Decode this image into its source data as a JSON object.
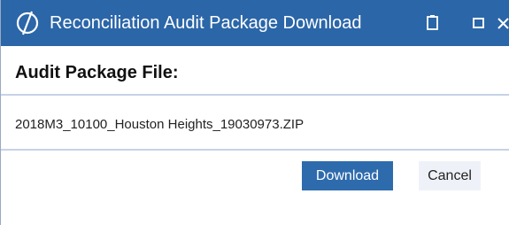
{
  "window": {
    "title": "Reconciliation Audit Package Download",
    "logo_icon": "oracle-logo-icon",
    "controls": {
      "pin_icon": "clipboard-icon",
      "maximize_icon": "maximize-icon",
      "close_icon": "close-icon"
    }
  },
  "dialog": {
    "heading": "Audit Package File:",
    "file_name": "2018M3_10100_Houston Heights_19030973.ZIP"
  },
  "actions": {
    "download_label": "Download",
    "cancel_label": "Cancel"
  },
  "colors": {
    "titlebar": "#2b66a8",
    "primary_button": "#2e6bad",
    "secondary_button": "#eef2f8",
    "divider": "#c6d3e6"
  }
}
